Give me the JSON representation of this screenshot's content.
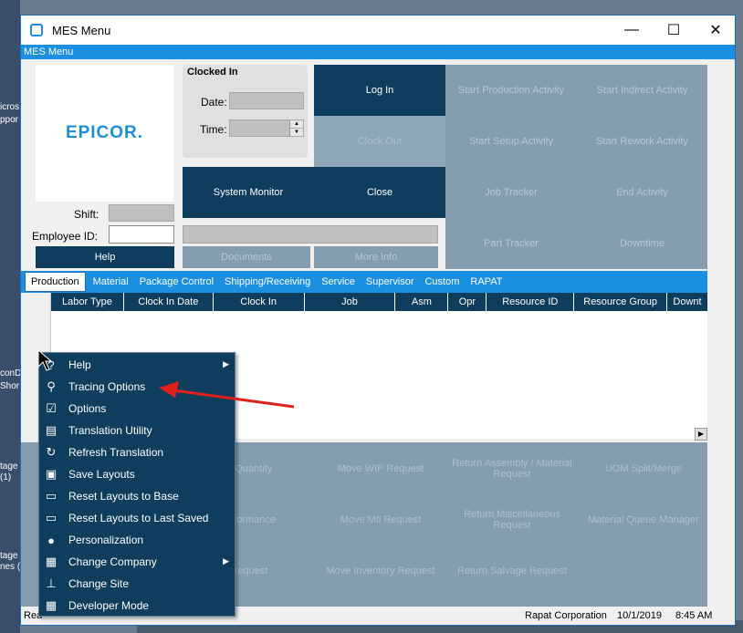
{
  "window": {
    "title": "MES Menu",
    "menubar": "MES Menu",
    "min": "—",
    "max": "☐",
    "close": "✕"
  },
  "logo": "EPICOR.",
  "clocked_in": {
    "title": "Clocked In",
    "date_label": "Date:",
    "time_label": "Time:"
  },
  "shift_label": "Shift:",
  "employee_label": "Employee ID:",
  "tiles": {
    "log_in": "Log In",
    "start_production": "Start Production Activity",
    "start_indirect": "Start Indirect Activity",
    "clock_out": "Clock Out",
    "start_setup": "Start Setup Activity",
    "start_rework": "Start Rework Activity",
    "system_monitor": "System Monitor",
    "close": "Close",
    "job_tracker": "Job Tracker",
    "end_activity": "End Activity",
    "part_tracker": "Part Tracker",
    "downtime": "Downtime"
  },
  "buttons": {
    "help": "Help",
    "documents": "Documents",
    "more_info": "More Info"
  },
  "tabs": [
    "Production",
    "Material",
    "Package Control",
    "Shipping/Receiving",
    "Service",
    "Supervisor",
    "Custom",
    "RAPAT"
  ],
  "grid": {
    "columns": [
      "Labor Type",
      "Clock In Date",
      "Clock In",
      "Job",
      "Asm",
      "Opr",
      "Resource ID",
      "Resource Group",
      "Downt"
    ]
  },
  "bottom_tiles": {
    "report_quantity": "rt Quantity",
    "move_wip": "Move WIP Request",
    "return_assembly": "Return Assembly / Material Request",
    "uom_split": "UOM Split/Merge",
    "nonconformance": "onformance",
    "move_mtl": "Move Mtl Request",
    "return_misc": "Return Miscellaneous Request",
    "material_queue": "Material Queue Manager",
    "request": "Request",
    "move_inventory": "Move Inventory Request",
    "return_salvage": "Return Salvage Request"
  },
  "status": {
    "ready": "Rea",
    "company": "Rapat Corporation",
    "date": "10/1/2019",
    "time": "8:45 AM"
  },
  "context_menu": [
    {
      "label": "Help",
      "icon": "help-icon",
      "glyph": "?",
      "submenu": true
    },
    {
      "label": "Tracing Options",
      "icon": "tracing-icon",
      "glyph": "⚲",
      "submenu": false
    },
    {
      "label": "Options",
      "icon": "options-icon",
      "glyph": "☑",
      "submenu": false
    },
    {
      "label": "Translation Utility",
      "icon": "translation-icon",
      "glyph": "▤",
      "submenu": false
    },
    {
      "label": "Refresh Translation",
      "icon": "refresh-icon",
      "glyph": "↻",
      "submenu": false
    },
    {
      "label": "Save Layouts",
      "icon": "save-icon",
      "glyph": "▣",
      "submenu": false
    },
    {
      "label": "Reset Layouts to Base",
      "icon": "reset-base-icon",
      "glyph": "▭",
      "submenu": false
    },
    {
      "label": "Reset Layouts to Last Saved",
      "icon": "reset-saved-icon",
      "glyph": "▭",
      "submenu": false
    },
    {
      "label": "Personalization",
      "icon": "person-icon",
      "glyph": "●",
      "submenu": false
    },
    {
      "label": "Change Company",
      "icon": "company-icon",
      "glyph": "▦",
      "submenu": true
    },
    {
      "label": "Change Site",
      "icon": "site-icon",
      "glyph": "⊥",
      "submenu": false
    },
    {
      "label": "Developer Mode",
      "icon": "developer-icon",
      "glyph": "▦",
      "submenu": false
    }
  ],
  "desktop": {
    "icon1": "icros",
    "icon1b": "ppor",
    "icon2": "conD",
    "icon2b": "Shor",
    "icon3": "tage",
    "icon3b": "(1)",
    "icon4": "tage",
    "icon4b": "nes ("
  }
}
